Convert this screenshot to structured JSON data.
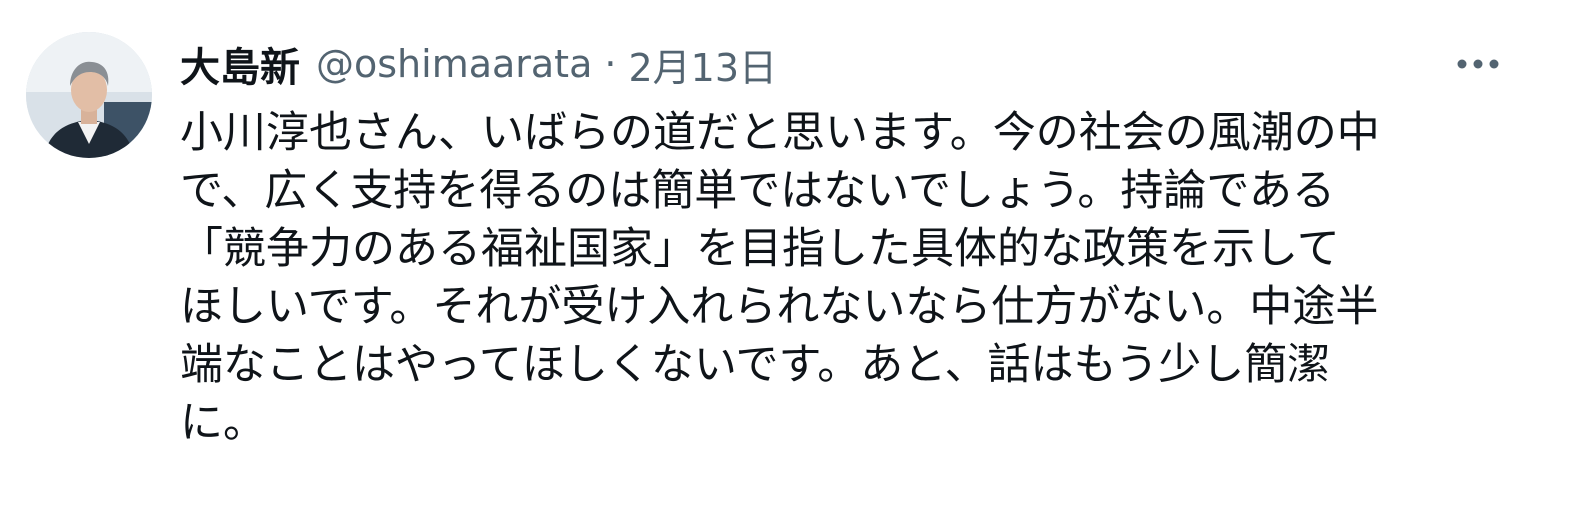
{
  "tweet": {
    "author": {
      "display_name": "大島新",
      "handle": "@oshimaarata",
      "avatar_icon": "profile-photo"
    },
    "separator": "·",
    "date": "2月13日",
    "more_icon": "more-horizontal-icon",
    "text_lines": [
      "小川淳也さん、いばらの道だと思います。今の社会の風潮の中",
      "で、広く支持を得るのは簡単ではないでしょう。持論である",
      "「競争力のある福祉国家」を目指した具体的な政策を示して",
      "ほしいです。それが受け入れられないなら仕方がない。中途半",
      "端なことはやってほしくないです。あと、話はもう少し簡潔",
      "に。"
    ]
  },
  "colors": {
    "primary_text": "#0f1419",
    "secondary_text": "#536471",
    "background": "#ffffff"
  }
}
